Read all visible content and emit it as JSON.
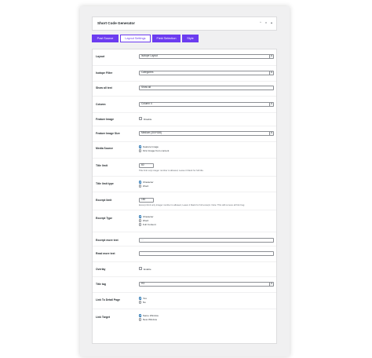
{
  "header": {
    "title": "Short Code Generator",
    "collapse_icon": "chevron-up-icon",
    "expand_icon": "chevron-down-icon",
    "toggle_icon": "triangle-icon",
    "collapse_glyph": "^",
    "expand_glyph": "v",
    "toggle_glyph": "▴"
  },
  "tabs": [
    {
      "label": "Post Source",
      "active": false
    },
    {
      "label": "Layout Settings",
      "active": true
    },
    {
      "label": "Field Selection",
      "active": false
    },
    {
      "label": "Style",
      "active": false
    }
  ],
  "fields": {
    "layout": {
      "label": "Layout",
      "value": "Isotope Layout"
    },
    "isotope_filter": {
      "label": "Isotope Filter",
      "value": "Categories"
    },
    "show_all_text": {
      "label": "Show all text",
      "value": "Show all"
    },
    "column": {
      "label": "Column",
      "value": "Column 4"
    },
    "feature_image": {
      "label": "Feature Image",
      "option": "Disable"
    },
    "feature_image_size": {
      "label": "Feature Image Size",
      "value": "Medium (300*300)"
    },
    "media_source": {
      "label": "Media Source",
      "options": [
        "Feature Image",
        "First Image from content"
      ],
      "selected": 0
    },
    "title_limit": {
      "label": "Title limit",
      "value": "60",
      "description": "Title limit only integer number is allowed, Leave it blank for full title."
    },
    "title_limit_type": {
      "label": "Title limit type",
      "options": [
        "Character",
        "Word"
      ],
      "selected": 0
    },
    "excerpt_limit": {
      "label": "Excerpt limit",
      "value": "150",
      "description": "Excerpt limit only integer number is allowed, Leave it blank for full excerpt. Note: This will remove all html tag"
    },
    "excerpt_type": {
      "label": "Excerpt Type",
      "options": [
        "Character",
        "Word",
        "Full Content"
      ],
      "selected": 0
    },
    "excerpt_more_text": {
      "label": "Excerpt more text",
      "value": "..."
    },
    "read_more_text": {
      "label": "Read more text",
      "value": ""
    },
    "overlay": {
      "label": "Overlay",
      "option": "Enable"
    },
    "title_tag": {
      "label": "Title tag",
      "value": "H3"
    },
    "link_to_detail_page": {
      "label": "Link To Detail Page",
      "options": [
        "Yes",
        "No"
      ],
      "selected": 0
    },
    "link_target": {
      "label": "Link Target",
      "options": [
        "Same Window",
        "New Window"
      ],
      "selected": 0
    }
  },
  "select_arrow_icon": "updown-arrow-icon",
  "select_arrow_glyph": "⬍",
  "colors": {
    "accent": "#6c3cf0",
    "radio": "#2271b1"
  }
}
